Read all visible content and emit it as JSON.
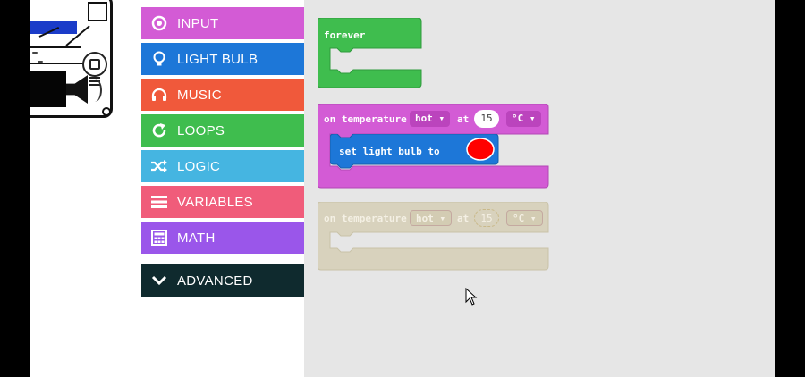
{
  "toolbox": {
    "categories": [
      {
        "label": "INPUT",
        "icon": "radio-button-icon",
        "color": "#d35bd5"
      },
      {
        "label": "LIGHT BULB",
        "icon": "lightbulb-icon",
        "color": "#1d77d8"
      },
      {
        "label": "MUSIC",
        "icon": "headphones-icon",
        "color": "#f0593b"
      },
      {
        "label": "LOOPS",
        "icon": "refresh-icon",
        "color": "#3fbd4e"
      },
      {
        "label": "LOGIC",
        "icon": "shuffle-icon",
        "color": "#45b5e1"
      },
      {
        "label": "VARIABLES",
        "icon": "list-icon",
        "color": "#f05c7a"
      },
      {
        "label": "MATH",
        "icon": "calculator-icon",
        "color": "#9a56ea"
      }
    ],
    "advanced": {
      "label": "ADVANCED",
      "icon": "chevron-down-icon",
      "color": "#0f2a2e"
    }
  },
  "blocks": {
    "forever": {
      "label": "forever",
      "color": "#3fbd4e"
    },
    "on_temp": {
      "label": "on temperature",
      "condition": "hot",
      "at_label": "at",
      "value": "15",
      "unit": "°C",
      "color": "#d35bd5"
    },
    "set_bulb": {
      "label": "set light bulb to",
      "color": "#1d77d8",
      "swatch": "#ff0000"
    },
    "on_temp_disabled": {
      "label": "on temperature",
      "condition": "hot",
      "at_label": "at",
      "value": "15",
      "unit": "°C",
      "color": "#d8d2bd"
    }
  }
}
